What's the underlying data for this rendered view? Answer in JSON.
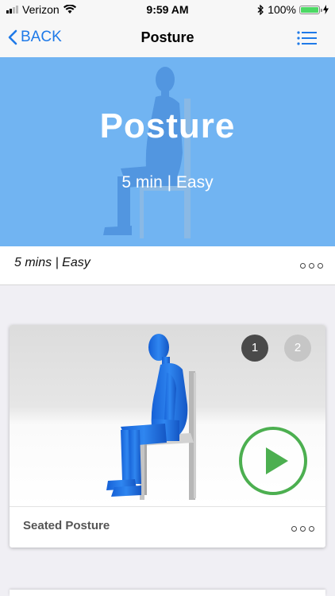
{
  "status_bar": {
    "carrier": "Verizon",
    "time": "9:59 AM",
    "battery_percent": "100%",
    "battery_level": 1.0
  },
  "nav": {
    "back_label": "BACK",
    "title": "Posture",
    "menu_icon": "list-icon"
  },
  "hero": {
    "title": "Posture",
    "subtitle": "5 min | Easy"
  },
  "info": {
    "text": "5 mins | Easy",
    "more_icon": "more-dots-icon"
  },
  "exercise_card": {
    "pages": [
      "1",
      "2"
    ],
    "active_page": "1",
    "label": "Seated Posture",
    "play_icon": "play-icon",
    "more_icon": "more-dots-icon"
  },
  "colors": {
    "accent": "#1f7ae8",
    "hero_bg": "#71b4f2",
    "figure": "#1a73e8",
    "play": "#4caf50",
    "battery": "#4cd964"
  }
}
